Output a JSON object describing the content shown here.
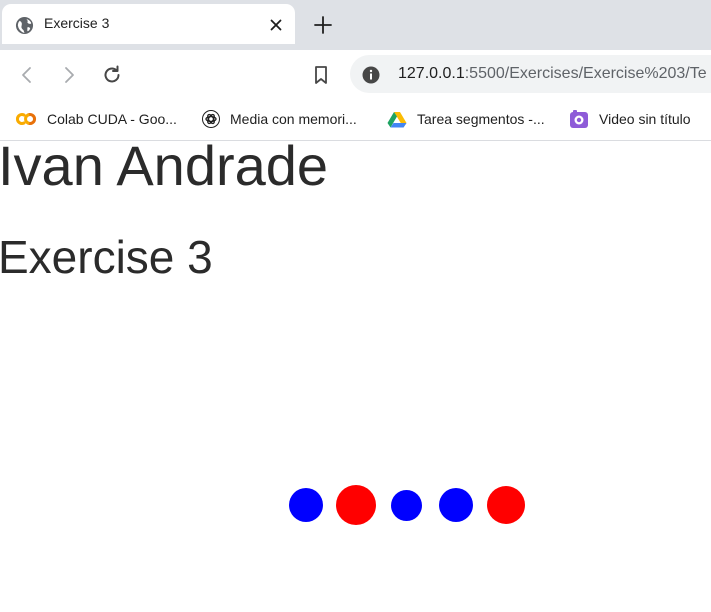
{
  "browser": {
    "tab": {
      "title": "Exercise 3",
      "favicon": "globe-icon"
    },
    "toolbar": {
      "url_host": "127.0.0.1",
      "url_path": ":5500/Exercises/Exercise%203/Te"
    },
    "bookmarks": [
      {
        "label": "Colab CUDA - Goo...",
        "icon": "colab-icon"
      },
      {
        "label": "Media con memori...",
        "icon": "openai-icon"
      },
      {
        "label": "Tarea segmentos -...",
        "icon": "google-drive-icon"
      },
      {
        "label": "Video sin título",
        "icon": "video-icon"
      }
    ]
  },
  "page": {
    "heading": "Ivan Andrade",
    "subheading": "Exercise 3",
    "circles": [
      {
        "color": "#0000ff"
      },
      {
        "color": "#ff0000"
      },
      {
        "color": "#0000ff"
      },
      {
        "color": "#0000ff"
      },
      {
        "color": "#ff0000"
      }
    ]
  },
  "colors": {
    "tabstrip": "#dee1e6",
    "omnibox": "#f1f3f4",
    "heading_text": "#2b2b2b"
  }
}
